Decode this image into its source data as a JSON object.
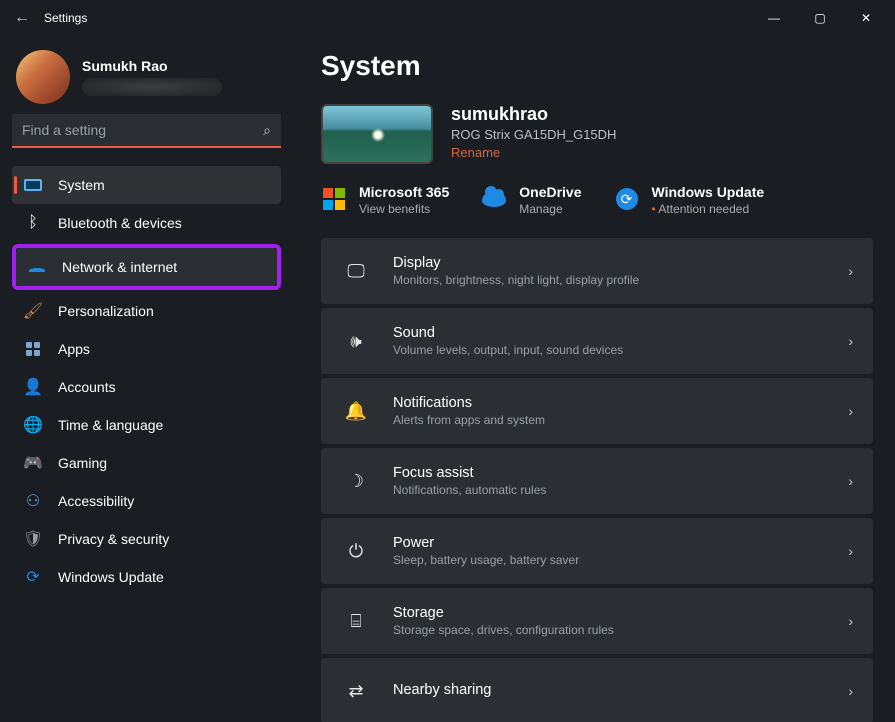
{
  "window": {
    "title": "Settings"
  },
  "profile": {
    "name": "Sumukh Rao"
  },
  "search": {
    "placeholder": "Find a setting"
  },
  "nav": [
    {
      "id": "system",
      "label": "System",
      "icon": "system-icon",
      "active": true
    },
    {
      "id": "bluetooth",
      "label": "Bluetooth & devices",
      "icon": "bluetooth-icon"
    },
    {
      "id": "network",
      "label": "Network & internet",
      "icon": "wifi-icon",
      "highlighted": true
    },
    {
      "id": "personalization",
      "label": "Personalization",
      "icon": "brush-icon"
    },
    {
      "id": "apps",
      "label": "Apps",
      "icon": "apps-icon"
    },
    {
      "id": "accounts",
      "label": "Accounts",
      "icon": "person-icon"
    },
    {
      "id": "time",
      "label": "Time & language",
      "icon": "globe-clock-icon"
    },
    {
      "id": "gaming",
      "label": "Gaming",
      "icon": "gamepad-icon"
    },
    {
      "id": "accessibility",
      "label": "Accessibility",
      "icon": "accessibility-icon"
    },
    {
      "id": "privacy",
      "label": "Privacy & security",
      "icon": "shield-icon"
    },
    {
      "id": "update",
      "label": "Windows Update",
      "icon": "sync-icon"
    }
  ],
  "page": {
    "title": "System"
  },
  "device": {
    "hostname": "sumukhrao",
    "model": "ROG Strix GA15DH_G15DH",
    "rename_label": "Rename"
  },
  "status": {
    "m365": {
      "title": "Microsoft 365",
      "sub": "View benefits"
    },
    "onedrive": {
      "title": "OneDrive",
      "sub": "Manage"
    },
    "update": {
      "title": "Windows Update",
      "sub": "Attention needed"
    }
  },
  "cards": [
    {
      "id": "display",
      "icon": "display-icon",
      "title": "Display",
      "sub": "Monitors, brightness, night light, display profile"
    },
    {
      "id": "sound",
      "icon": "sound-icon",
      "title": "Sound",
      "sub": "Volume levels, output, input, sound devices"
    },
    {
      "id": "notifications",
      "icon": "bell-icon",
      "title": "Notifications",
      "sub": "Alerts from apps and system"
    },
    {
      "id": "focus",
      "icon": "moon-icon",
      "title": "Focus assist",
      "sub": "Notifications, automatic rules"
    },
    {
      "id": "power",
      "icon": "power-icon",
      "title": "Power",
      "sub": "Sleep, battery usage, battery saver"
    },
    {
      "id": "storage",
      "icon": "drive-icon",
      "title": "Storage",
      "sub": "Storage space, drives, configuration rules"
    },
    {
      "id": "nearby",
      "icon": "nearby-icon",
      "title": "Nearby sharing",
      "sub": ""
    }
  ],
  "icons": {
    "display-icon": "🖵",
    "sound-icon": "🕪",
    "bell-icon": "🔔",
    "moon-icon": "☽",
    "power-icon": "⏻",
    "drive-icon": "⌸",
    "nearby-icon": "⇄",
    "bluetooth-icon": "ᛒ",
    "brush-icon": "🖌",
    "person-icon": "👤",
    "globe-clock-icon": "🌐",
    "gamepad-icon": "🎮",
    "accessibility-icon": "⚇",
    "shield-icon": "🛡",
    "sync-icon": "⟳"
  }
}
